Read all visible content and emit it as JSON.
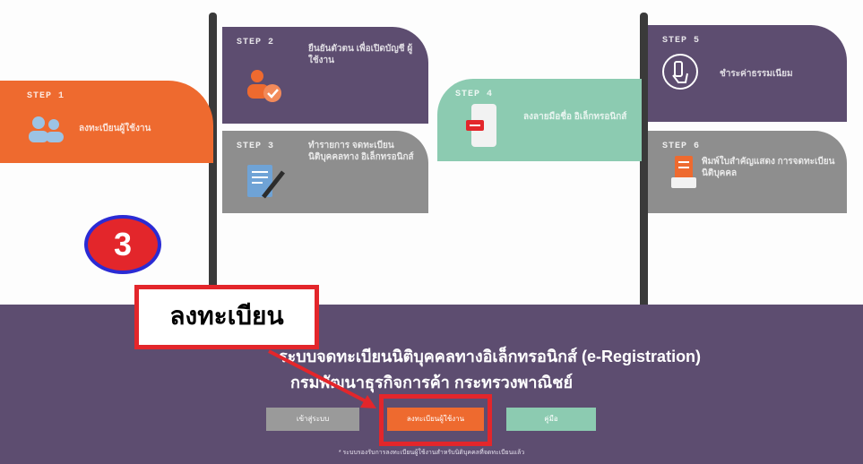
{
  "steps": [
    {
      "label": "STEP 1",
      "text": "ลงทะเบียนผู้ใช้งาน"
    },
    {
      "label": "STEP 2",
      "text": "ยืนยันตัวตน เพื่อเปิดบัญชี ผู้ใช้งาน"
    },
    {
      "label": "STEP 3",
      "text": "ทำรายการ จดทะเบียน นิติบุคคลทาง อิเล็กทรอนิกส์"
    },
    {
      "label": "STEP 4",
      "text": "ลงลายมือชื่อ อิเล็กทรอนิกส์"
    },
    {
      "label": "STEP 5",
      "text": "ชำระค่าธรรมเนียม"
    },
    {
      "label": "STEP 6",
      "text": "พิมพ์ใบสำคัญแสดง การจดทะเบียนนิติบุคคล"
    }
  ],
  "banner": {
    "title_line1": "ระบบจดทะเบียนนิติบุคคลทางอิเล็กทรอนิกส์ (e-Registration)",
    "title_line2": "กรมพัฒนาธุรกิจการค้า กระทรวงพาณิชย์",
    "buttons": [
      "เข้าสู่ระบบ",
      "ลงทะเบียนผู้ใช้งาน",
      "คู่มือ"
    ],
    "note": "* ระบบรองรับการลงทะเบียนผู้ใช้งานสำหรับนิติบุคคลที่จดทะเบียนแล้ว"
  },
  "annotation": {
    "badge_number": "3",
    "callout_text": "ลงทะเบียน"
  },
  "colors": {
    "orange": "#ee6a2f",
    "purple": "#5d4d70",
    "gray": "#8e8e8e",
    "green": "#8ccbb1",
    "red": "#e3262b",
    "badge_border": "#2b2bd4"
  }
}
